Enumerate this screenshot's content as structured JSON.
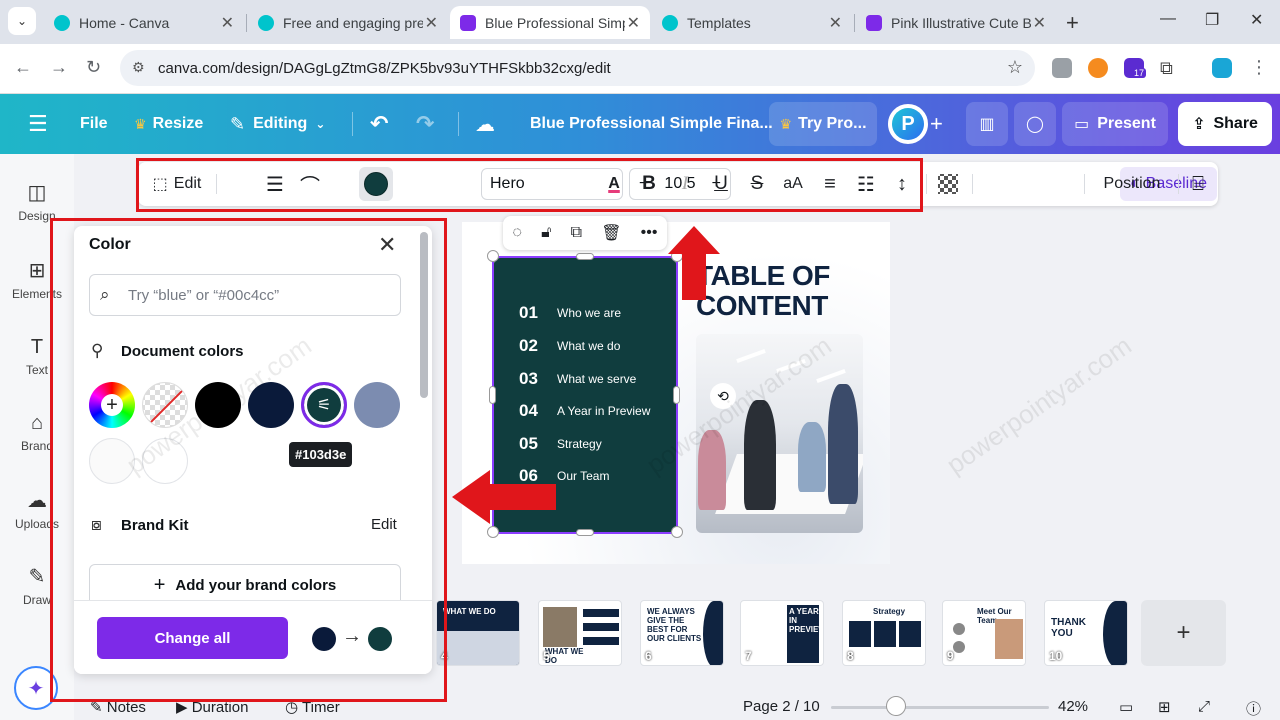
{
  "browser": {
    "tabs": [
      {
        "label": "Home - Canva"
      },
      {
        "label": "Free and engaging prese"
      },
      {
        "label": "Blue Professional Simple"
      },
      {
        "label": "Templates"
      },
      {
        "label": "Pink Illustrative Cute Bra"
      }
    ],
    "url": "canva.com/design/DAGgLgZtmG8/ZPK5bv93uYTHFSkbb32cxg/edit",
    "ext_badge": "17"
  },
  "header": {
    "file": "File",
    "resize": "Resize",
    "editing": "Editing",
    "doc_title": "Blue Professional Simple Fina...",
    "try_pro": "Try Pro...",
    "avatar_letter": "P",
    "present": "Present",
    "share": "Share"
  },
  "rail": [
    {
      "label": "Design"
    },
    {
      "label": "Elements"
    },
    {
      "label": "Text"
    },
    {
      "label": "Brand"
    },
    {
      "label": "Uploads"
    },
    {
      "label": "Draw"
    }
  ],
  "toolbar": {
    "edit": "Edit",
    "font": "Hero",
    "font_size": "10.5",
    "case": "aA",
    "baseline": "Baseline",
    "position": "Position",
    "current_color": "#103d3e"
  },
  "color_panel": {
    "title": "Color",
    "search_placeholder": "Try “blue” or “#00c4cc”",
    "document_colors_title": "Document colors",
    "swatches": [
      "#000000",
      "#0a1a3a",
      "#103d3e",
      "#7c8cb0",
      "#fafafa",
      "#ffffff"
    ],
    "tooltip": "#103d3e",
    "brand_kit": "Brand Kit",
    "brand_edit": "Edit",
    "add_brand": "Add your brand colors",
    "change_all": "Change all",
    "from_color": "#0a1a3a",
    "to_color": "#103d3e"
  },
  "slide": {
    "title_line1": "TABLE OF",
    "title_line2": "CONTENT",
    "items": [
      {
        "num": "01",
        "text": "Who we are"
      },
      {
        "num": "02",
        "text": "What we do"
      },
      {
        "num": "03",
        "text": "What we serve"
      },
      {
        "num": "04",
        "text": "A Year in Preview"
      },
      {
        "num": "05",
        "text": "Strategy"
      },
      {
        "num": "06",
        "text": "Our Team"
      }
    ]
  },
  "thumbnails": [
    {
      "num": "4",
      "title": "WHAT WE DO"
    },
    {
      "num": "5",
      "title": "WHAT WE DO"
    },
    {
      "num": "6",
      "title": "WE ALWAYS GIVE THE BEST FOR OUR CLIENTS"
    },
    {
      "num": "7",
      "title": "A YEAR IN PREVIEW"
    },
    {
      "num": "8",
      "title": "Strategy"
    },
    {
      "num": "9",
      "title": "Meet Our Team"
    },
    {
      "num": "10",
      "title": "THANK YOU"
    }
  ],
  "footer": {
    "notes": "Notes",
    "duration": "Duration",
    "timer": "Timer",
    "page": "Page 2 / 10",
    "zoom": "42%",
    "zoom_level": 0.3
  },
  "watermark": "powerpointyar.com"
}
